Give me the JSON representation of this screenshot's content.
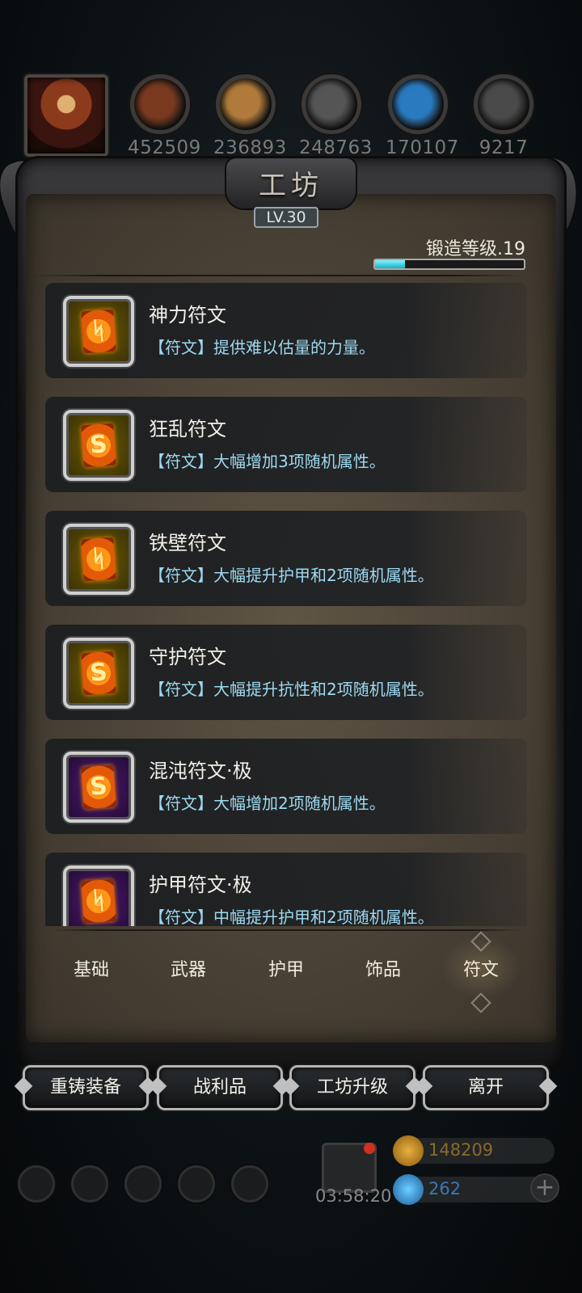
{
  "resources": [
    {
      "id": "meat",
      "value": "452509",
      "color": "#7a3a20"
    },
    {
      "id": "wood",
      "value": "236893",
      "color": "#b07a3a"
    },
    {
      "id": "iron",
      "value": "248763",
      "color": "#555555"
    },
    {
      "id": "crystal",
      "value": "170107",
      "color": "#2a7ac0"
    },
    {
      "id": "steel",
      "value": "9217",
      "color": "#4a4a4a"
    }
  ],
  "panel": {
    "title": "工坊",
    "level": "LV.30",
    "forge_label": "锻造等级.19",
    "forge_progress": 0.2
  },
  "items": [
    {
      "name": "神力符文",
      "desc": "【符文】提供难以估量的力量。",
      "frame": "gold",
      "glyph": "ᛋ"
    },
    {
      "name": "狂乱符文",
      "desc": "【符文】大幅增加3项随机属性。",
      "frame": "gold",
      "glyph": "S"
    },
    {
      "name": "铁壁符文",
      "desc": "【符文】大幅提升护甲和2项随机属性。",
      "frame": "gold",
      "glyph": "ᛋ"
    },
    {
      "name": "守护符文",
      "desc": "【符文】大幅提升抗性和2项随机属性。",
      "frame": "gold",
      "glyph": "S"
    },
    {
      "name": "混沌符文·极",
      "desc": "【符文】大幅增加2项随机属性。",
      "frame": "purple",
      "glyph": "S"
    },
    {
      "name": "护甲符文·极",
      "desc": "【符文】中幅提升护甲和2项随机属性。",
      "frame": "purple",
      "glyph": "ᛋ"
    }
  ],
  "tabs": [
    "基础",
    "武器",
    "护甲",
    "饰品",
    "符文"
  ],
  "active_tab": "符文",
  "buttons": {
    "reforge": "重铸装备",
    "loot": "战利品",
    "upgrade": "工坊升级",
    "leave": "离开"
  },
  "bottom": {
    "timer": "03:58:20",
    "gold": "148209",
    "gems": "262"
  }
}
